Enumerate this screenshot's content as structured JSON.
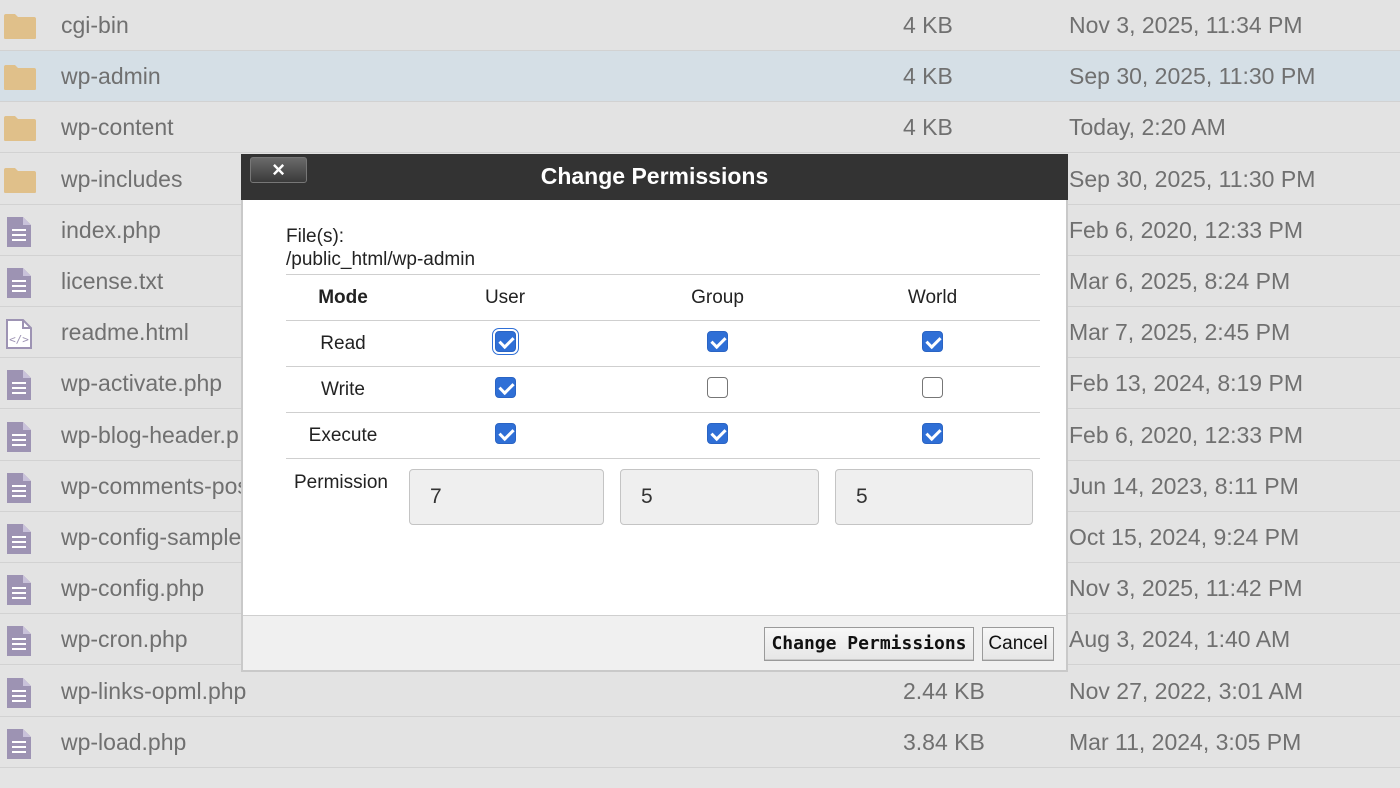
{
  "files": [
    {
      "name": "cgi-bin",
      "size": "4 KB",
      "date": "Nov 3, 2025, 11:34 PM",
      "type": "folder",
      "icon": "folder-icon"
    },
    {
      "name": "wp-admin",
      "size": "4 KB",
      "date": "Sep 30, 2025, 11:30 PM",
      "type": "folder",
      "icon": "folder-icon",
      "selected": true
    },
    {
      "name": "wp-content",
      "size": "4 KB",
      "date": "Today, 2:20 AM",
      "type": "folder",
      "icon": "folder-icon"
    },
    {
      "name": "wp-includes",
      "size": "",
      "date": "Sep 30, 2025, 11:30 PM",
      "type": "folder",
      "icon": "folder-icon"
    },
    {
      "name": "index.php",
      "size": "",
      "date": "Feb 6, 2020, 12:33 PM",
      "type": "file",
      "icon": "text-file-icon"
    },
    {
      "name": "license.txt",
      "size": "",
      "date": "Mar 6, 2025, 8:24 PM",
      "type": "file",
      "icon": "text-file-icon"
    },
    {
      "name": "readme.html",
      "size": "",
      "date": "Mar 7, 2025, 2:45 PM",
      "type": "file",
      "icon": "code-file-icon"
    },
    {
      "name": "wp-activate.php",
      "size": "",
      "date": "Feb 13, 2024, 8:19 PM",
      "type": "file",
      "icon": "text-file-icon"
    },
    {
      "name": "wp-blog-header.p",
      "size": "",
      "date": "Feb 6, 2020, 12:33 PM",
      "type": "file",
      "icon": "text-file-icon"
    },
    {
      "name": "wp-comments-pos",
      "size": "",
      "date": "Jun 14, 2023, 8:11 PM",
      "type": "file",
      "icon": "text-file-icon"
    },
    {
      "name": "wp-config-sample",
      "size": "",
      "date": "Oct 15, 2024, 9:24 PM",
      "type": "file",
      "icon": "text-file-icon"
    },
    {
      "name": "wp-config.php",
      "size": "",
      "date": "Nov 3, 2025, 11:42 PM",
      "type": "file",
      "icon": "text-file-icon"
    },
    {
      "name": "wp-cron.php",
      "size": "",
      "date": "Aug 3, 2024, 1:40 AM",
      "type": "file",
      "icon": "text-file-icon"
    },
    {
      "name": "wp-links-opml.php",
      "size": "2.44 KB",
      "date": "Nov 27, 2022, 3:01 AM",
      "type": "file",
      "icon": "text-file-icon"
    },
    {
      "name": "wp-load.php",
      "size": "3.84 KB",
      "date": "Mar 11, 2024, 3:05 PM",
      "type": "file",
      "icon": "text-file-icon"
    }
  ],
  "modal": {
    "title": "Change Permissions",
    "close_label": "×",
    "files_label": "File(s):",
    "files_path": "/public_html/wp-admin",
    "headers": [
      "Mode",
      "User",
      "Group",
      "World"
    ],
    "rows": [
      {
        "label": "Read",
        "user": true,
        "group": true,
        "world": true
      },
      {
        "label": "Write",
        "user": true,
        "group": false,
        "world": false
      },
      {
        "label": "Execute",
        "user": true,
        "group": true,
        "world": true
      }
    ],
    "permission_label": "Permission",
    "permission_values": {
      "user": "7",
      "group": "5",
      "world": "5"
    },
    "submit_label": "Change Permissions",
    "cancel_label": "Cancel"
  },
  "colors": {
    "folder": "#e0c08a",
    "file": "#9d93b3",
    "checkbox": "#2f6fd6",
    "titlebar": "#333333"
  }
}
